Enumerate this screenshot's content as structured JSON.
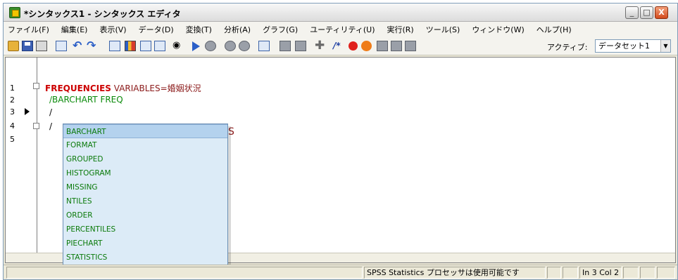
{
  "window": {
    "title": "*シンタックス1 - シンタックス エディタ",
    "controls": {
      "minimize": "_",
      "maximize": "□",
      "close": "X"
    }
  },
  "menu": {
    "items": [
      "ファイル(F)",
      "編集(E)",
      "表示(V)",
      "データ(D)",
      "変換(T)",
      "分析(A)",
      "グラフ(G)",
      "ユーティリティ(U)",
      "実行(R)",
      "ツール(S)",
      "ウィンドウ(W)",
      "ヘルプ(H)"
    ]
  },
  "toolbar": {
    "icons": [
      "open-icon",
      "save-icon",
      "print-icon",
      "dialog-recall-icon",
      "undo-icon",
      "redo-icon",
      "goto-data-icon",
      "variables-icon",
      "insert-icon",
      "help-icon",
      "find-icon",
      "run-icon",
      "comment-icon",
      "bookmark-icon",
      "breakpoint-icon",
      "toggle-icon",
      "record-icon",
      "check-icon",
      "step-icon",
      "stop-icon"
    ],
    "active_label": "アクティブ:",
    "dataset_value": "データセット1"
  },
  "editor": {
    "line_numbers": [
      "1",
      "2",
      "3",
      "4",
      "5"
    ],
    "line1_keyword": "FREQUENCIES",
    "line1_rest": " VARIABLES=婚姻状況",
    "line2": "/BARCHART FREQ",
    "line3": "/",
    "line4_prefix": "/",
    "line4_tail": "S"
  },
  "autocomplete": {
    "items": [
      "BARCHART",
      "FORMAT",
      "GROUPED",
      "HISTOGRAM",
      "MISSING",
      "NTILES",
      "ORDER",
      "PERCENTILES",
      "PIECHART",
      "STATISTICS"
    ],
    "selected_index": 0
  },
  "statusbar": {
    "processor": "SPSS Statistics プロセッサは使用可能です",
    "position": "In 3 Col 2"
  },
  "colors": {
    "keyword": "#cc0000",
    "subcommand": "#0a8a0a",
    "popup_bg": "#dcebf7"
  }
}
